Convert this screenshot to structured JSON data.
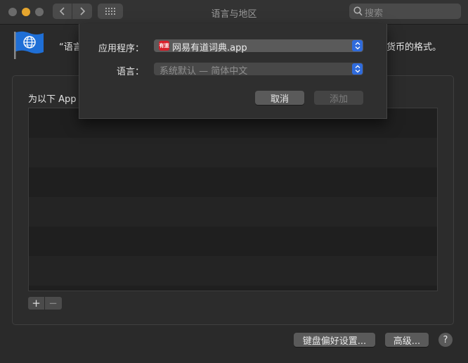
{
  "window": {
    "title": "语言与地区"
  },
  "search": {
    "placeholder": "搜索"
  },
  "header": {
    "description_left": "“语言",
    "description_right": "货币的格式。"
  },
  "panel": {
    "label": "为以下 App l",
    "rows": 6
  },
  "buttons": {
    "plus": "+",
    "minus": "−",
    "keyboard_prefs": "键盘偏好设置...",
    "advanced": "高级...",
    "help": "?"
  },
  "sheet": {
    "app_label": "应用程序：",
    "app_value": "网易有道词典.app",
    "app_icon_text": "有道",
    "lang_label": "语言：",
    "lang_value": "系统默认 — 简体中文",
    "cancel": "取消",
    "add": "添加"
  },
  "colors": {
    "accent": "#2f6bdc",
    "app_icon": "#d8202b",
    "minimize_light": "#e5a52e"
  }
}
